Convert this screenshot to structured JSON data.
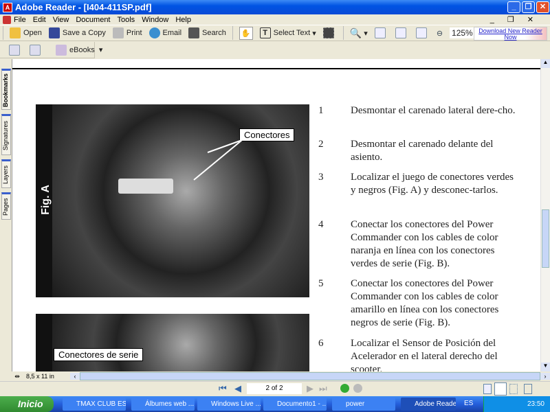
{
  "window": {
    "title": "Adobe Reader - [I404-411SP.pdf]",
    "minimize": "_",
    "restore": "❐",
    "close": "✕"
  },
  "menu": [
    "File",
    "Edit",
    "View",
    "Document",
    "Tools",
    "Window",
    "Help"
  ],
  "toolbar": {
    "open": "Open",
    "save_copy": "Save a Copy",
    "print": "Print",
    "email": "Email",
    "search": "Search",
    "select_text": "Select Text",
    "zoom_value": "125%",
    "download": "Download New Reader Now",
    "ebooks": "eBooks"
  },
  "side_tabs": [
    "Bookmarks",
    "Signatures",
    "Layers",
    "Pages"
  ],
  "document": {
    "fig_a_label": "Fig. A",
    "callout_a": "Conectores",
    "callout_b": "Conectores de serie",
    "steps": [
      {
        "num": "1",
        "text": "Desmontar el carenado lateral dere-cho."
      },
      {
        "num": "2",
        "text": "Desmontar el carenado delante del asiento."
      },
      {
        "num": "3",
        "text": "Localizar el juego de conectores verdes y negros (Fig. A) y desconec-tarlos."
      },
      {
        "num": "4",
        "text": "Conectar los conectores del Power Commander con los cables de color naranja en línea con los conectores verdes de serie (Fig. B)."
      },
      {
        "num": "5",
        "text": "Conectar los conectores del Power Commander con los cables de color amarillo en línea con los conectores negros de serie (Fig. B)."
      },
      {
        "num": "6",
        "text": "Localizar el Sensor de Posición del Acelerador en el lateral derecho del scooter."
      }
    ]
  },
  "status": {
    "page_size": "8,5 x 11 in",
    "page_indicator": "2 of 2"
  },
  "scroll": {
    "vertical_position_fraction": 0.6
  },
  "taskbar": {
    "start": "Inicio",
    "tasks": [
      "TMAX CLUB ES...",
      "Álbumes web ...",
      "Windows Live ...",
      "Documento1 - ...",
      "power",
      "Adobe Reader..."
    ],
    "lang": "ES",
    "clock": "23:50"
  }
}
